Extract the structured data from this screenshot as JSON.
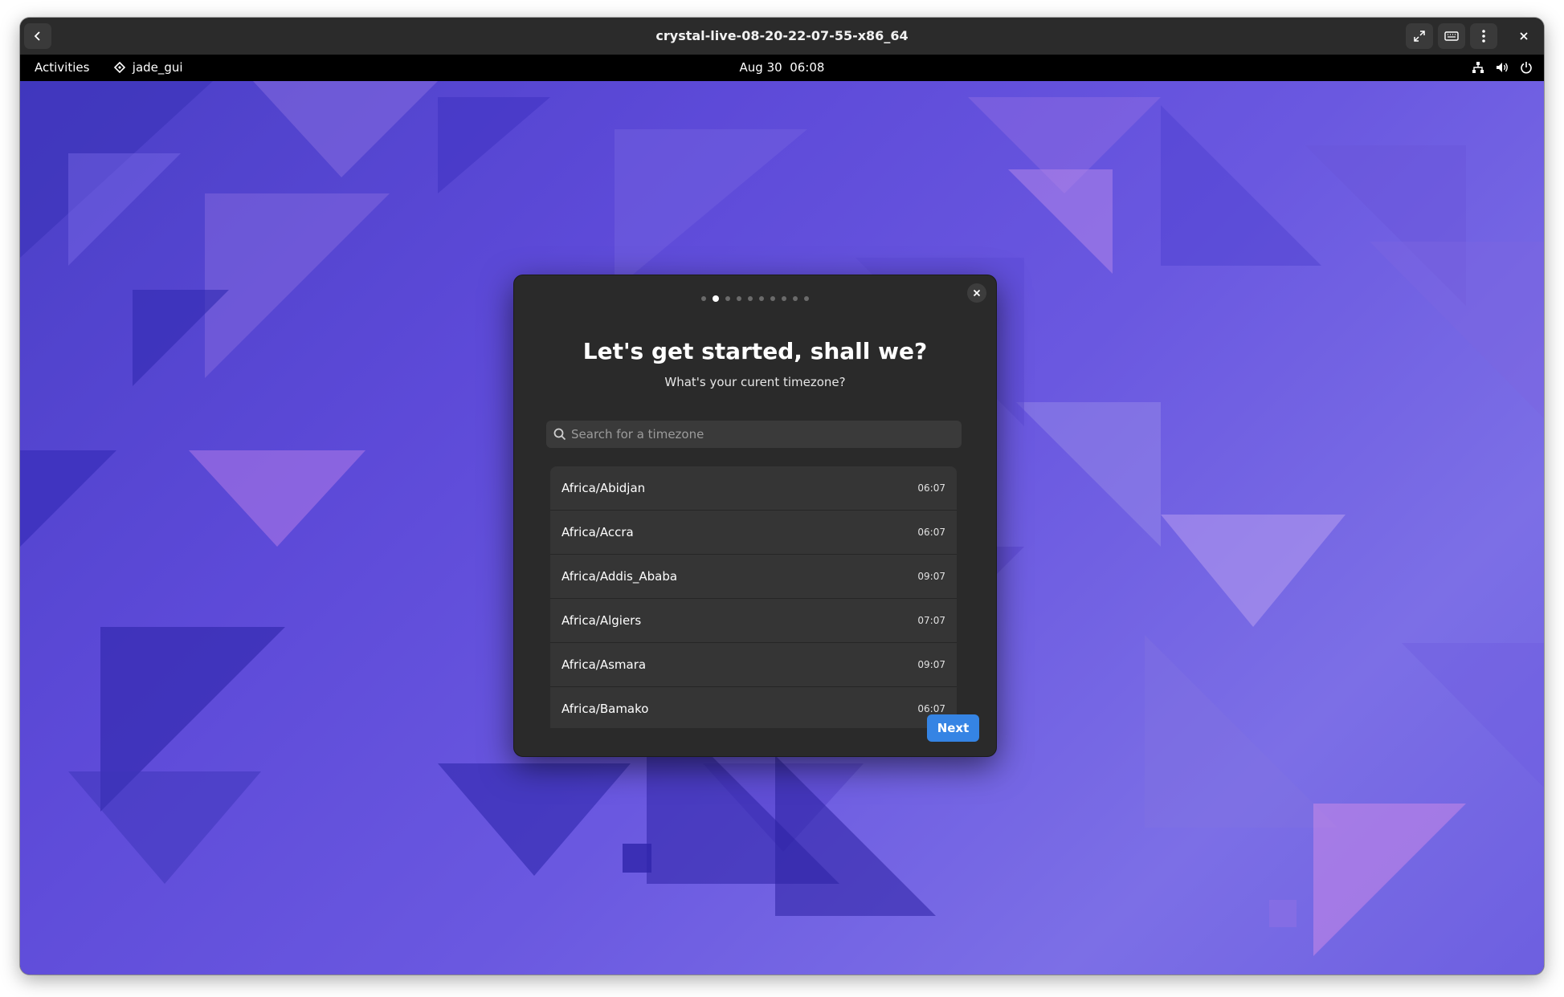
{
  "window": {
    "title": "crystal-live-08-20-22-07-55-x86_64"
  },
  "topbar": {
    "activities": "Activities",
    "app_name": "jade_gui",
    "clock": "Aug 30  06:08"
  },
  "dialog": {
    "step_count": 10,
    "active_step": 2,
    "heading": "Let's get started, shall we?",
    "subheading": "What's your curent timezone?",
    "search_placeholder": "Search for a timezone",
    "timezones": [
      {
        "name": "Africa/Abidjan",
        "time": "06:07"
      },
      {
        "name": "Africa/Accra",
        "time": "06:07"
      },
      {
        "name": "Africa/Addis_Ababa",
        "time": "09:07"
      },
      {
        "name": "Africa/Algiers",
        "time": "07:07"
      },
      {
        "name": "Africa/Asmara",
        "time": "09:07"
      },
      {
        "name": "Africa/Bamako",
        "time": "06:07"
      }
    ],
    "next_label": "Next"
  },
  "colors": {
    "accent": "#3584e4",
    "dialog_bg": "#2a2a2a",
    "row_bg": "#353535",
    "wallpaper_base": "#5d4ad8"
  },
  "icons": [
    "back-arrow-icon",
    "fullscreen-icon",
    "keyboard-icon",
    "kebab-menu-icon",
    "close-icon",
    "app-diamond-icon",
    "network-icon",
    "volume-icon",
    "power-icon",
    "search-icon"
  ]
}
